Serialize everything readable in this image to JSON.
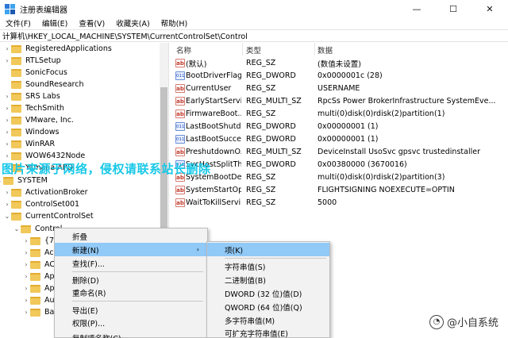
{
  "window": {
    "title": "注册表编辑器",
    "minimize": "—",
    "maximize": "☐",
    "close": "✕"
  },
  "menu": [
    "文件(F)",
    "编辑(E)",
    "查看(V)",
    "收藏夹(A)",
    "帮助(H)"
  ],
  "address": "计算机\\HKEY_LOCAL_MACHINE\\SYSTEM\\CurrentControlSet\\Control",
  "tree": [
    {
      "label": "RegisteredApplications",
      "arrow": "›"
    },
    {
      "label": "RTLSetup",
      "arrow": "›"
    },
    {
      "label": "SonicFocus",
      "arrow": ""
    },
    {
      "label": "SoundResearch",
      "arrow": ""
    },
    {
      "label": "SRS Labs",
      "arrow": "›"
    },
    {
      "label": "TechSmith",
      "arrow": "›"
    },
    {
      "label": "VMware, Inc.",
      "arrow": "›"
    },
    {
      "label": "Windows",
      "arrow": "›"
    },
    {
      "label": "WinRAR",
      "arrow": "›"
    },
    {
      "label": "WOW6432Node",
      "arrow": "›"
    },
    {
      "label": "Yamaha APO",
      "arrow": "›"
    },
    {
      "label": "SYSTEM",
      "arrow": "⌄"
    },
    {
      "label": "ActivationBroker",
      "arrow": "›"
    },
    {
      "label": "ControlSet001",
      "arrow": "›"
    },
    {
      "label": "CurrentControlSet",
      "arrow": "⌄"
    },
    {
      "label": "Control",
      "arrow": "⌄"
    },
    {
      "label": "{77",
      "arrow": "›"
    },
    {
      "label": "Ac",
      "arrow": "›"
    },
    {
      "label": "AC",
      "arrow": "›"
    },
    {
      "label": "Ap",
      "arrow": "›"
    },
    {
      "label": "Ap",
      "arrow": "›"
    },
    {
      "label": "Au",
      "arrow": "›"
    },
    {
      "label": "Ba",
      "arrow": "›"
    }
  ],
  "columns": {
    "name": "名称",
    "type": "类型",
    "data": "数据"
  },
  "values": [
    {
      "icon": "ab",
      "name": "(默认)",
      "type": "REG_SZ",
      "data": "(数值未设置)"
    },
    {
      "icon": "bin",
      "name": "BootDriverFlags",
      "type": "REG_DWORD",
      "data": "0x0000001c (28)"
    },
    {
      "icon": "ab",
      "name": "CurrentUser",
      "type": "REG_SZ",
      "data": "USERNAME"
    },
    {
      "icon": "ab",
      "name": "EarlyStartServi...",
      "type": "REG_MULTI_SZ",
      "data": "RpcSs Power BrokerInfrastructure SystemEve..."
    },
    {
      "icon": "ab",
      "name": "FirmwareBoot...",
      "type": "REG_SZ",
      "data": "multi(0)disk(0)rdisk(2)partition(1)"
    },
    {
      "icon": "bin",
      "name": "LastBootShutd...",
      "type": "REG_DWORD",
      "data": "0x00000001 (1)"
    },
    {
      "icon": "bin",
      "name": "LastBootSucce...",
      "type": "REG_DWORD",
      "data": "0x00000001 (1)"
    },
    {
      "icon": "ab",
      "name": "PreshutdownO...",
      "type": "REG_MULTI_SZ",
      "data": "DeviceInstall UsoSvc gpsvc trustedinstaller"
    },
    {
      "icon": "bin",
      "name": "SvcHostSplitTh...",
      "type": "REG_DWORD",
      "data": "0x00380000 (3670016)"
    },
    {
      "icon": "ab",
      "name": "SystemBootDe...",
      "type": "REG_SZ",
      "data": "multi(0)disk(0)rdisk(2)partition(3)"
    },
    {
      "icon": "ab",
      "name": "SystemStartOp...",
      "type": "REG_SZ",
      "data": " FLIGHTSIGNING  NOEXECUTE=OPTIN"
    },
    {
      "icon": "ab",
      "name": "WaitToKillServi...",
      "type": "REG_SZ",
      "data": "5000"
    }
  ],
  "watermark": "图片来源于网络，侵权请联系站长删除",
  "logo": "@小自系统",
  "context_menu": {
    "collapse": "折叠",
    "new": "新建(N)",
    "find": "查找(F)...",
    "delete": "删除(D)",
    "rename": "重命名(R)",
    "export": "导出(E)",
    "permissions": "权限(P)...",
    "copy_key": "复制项名称(C)",
    "arrow": "›"
  },
  "submenu": {
    "key": "项(K)",
    "string": "字符串值(S)",
    "binary": "二进制值(B)",
    "dword": "DWORD (32 位)值(D)",
    "qword": "QWORD (64 位)值(Q)",
    "multi": "多字符串值(M)",
    "expand": "可扩充字符串值(E)"
  }
}
